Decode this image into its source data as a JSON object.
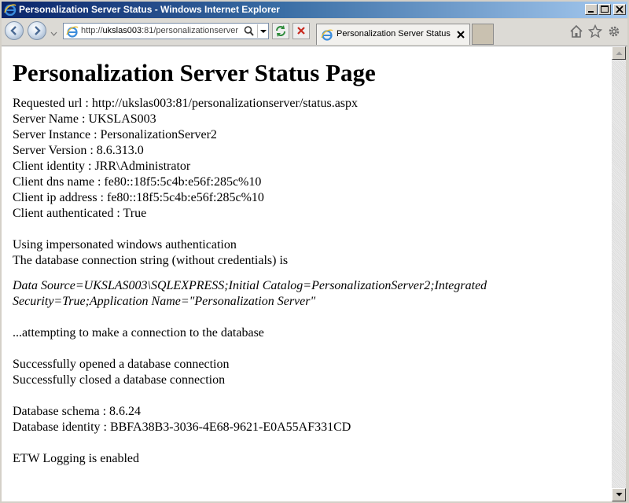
{
  "window": {
    "title": "Personalization Server Status - Windows Internet Explorer"
  },
  "toolbar": {
    "address_prefix": "http://",
    "address_host": "ukslas003",
    "address_rest": ":81/personalizationserver",
    "tab_label": "Personalization Server Status"
  },
  "page": {
    "heading": "Personalization Server Status Page",
    "info_lines": [
      "Requested url : http://ukslas003:81/personalizationserver/status.aspx",
      "Server Name : UKSLAS003",
      "Server Instance : PersonalizationServer2",
      "Server Version : 8.6.313.0",
      "Client identity : JRR\\Administrator",
      "Client dns name : fe80::18f5:5c4b:e56f:285c%10",
      "Client ip address : fe80::18f5:5c4b:e56f:285c%10",
      "Client authenticated : True"
    ],
    "auth_line": "Using impersonated windows authentication",
    "connstr_intro": "The database connection string (without credentials) is",
    "connstr": "Data Source=UKSLAS003\\SQLEXPRESS;Initial Catalog=PersonalizationServer2;Integrated Security=True;Application Name=\"Personalization Server\"",
    "attempt_line": "...attempting to make a connection to the database",
    "opened_line": "Successfully opened a database connection",
    "closed_line": "Successfully closed a database connection",
    "schema_line": "Database schema : 8.6.24",
    "identity_line": "Database identity : BBFA38B3-3036-4E68-9621-E0A55AF331CD",
    "etw_line": "ETW Logging is enabled"
  }
}
